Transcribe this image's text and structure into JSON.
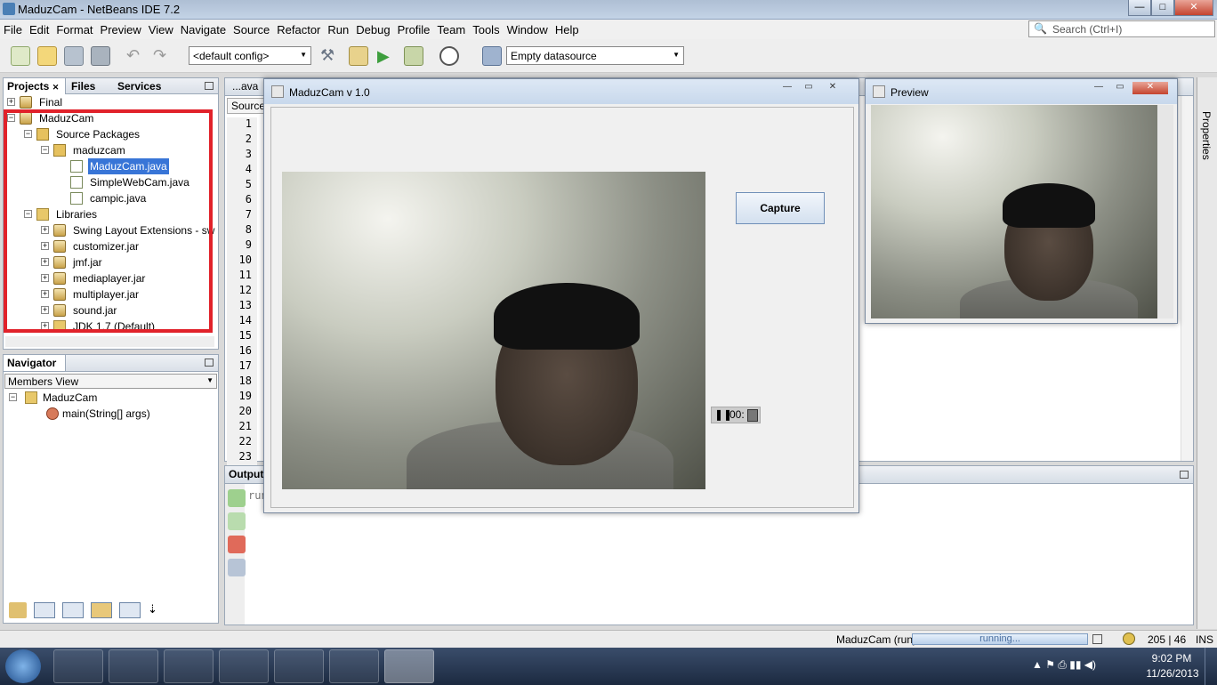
{
  "window": {
    "title": "MaduzCam - NetBeans IDE 7.2"
  },
  "menu": [
    "File",
    "Edit",
    "Format",
    "Preview",
    "View",
    "Navigate",
    "Source",
    "Refactor",
    "Run",
    "Debug",
    "Profile",
    "Team",
    "Tools",
    "Window",
    "Help"
  ],
  "search": {
    "placeholder": "Search (Ctrl+I)"
  },
  "toolbar": {
    "config": "<default config>",
    "datasource": "Empty datasource"
  },
  "projects_panel": {
    "tabs": [
      "Projects",
      "Files",
      "Services"
    ],
    "tree": [
      {
        "label": "Final"
      },
      {
        "label": "MaduzCam"
      },
      {
        "label": "Source Packages"
      },
      {
        "label": "maduzcam"
      },
      {
        "label": "MaduzCam.java"
      },
      {
        "label": "SimpleWebCam.java"
      },
      {
        "label": "campic.java"
      },
      {
        "label": "Libraries"
      },
      {
        "label": "Swing Layout Extensions - sw"
      },
      {
        "label": "customizer.jar"
      },
      {
        "label": "jmf.jar"
      },
      {
        "label": "mediaplayer.jar"
      },
      {
        "label": "multiplayer.jar"
      },
      {
        "label": "sound.jar"
      },
      {
        "label": "JDK 1.7 (Default)"
      }
    ]
  },
  "navigator": {
    "title": "Navigator",
    "view": "Members View",
    "class_name": "MaduzCam",
    "member": "main(String[] args)"
  },
  "editor": {
    "tab": "...ava",
    "source_tab": "Source",
    "line_numbers": [
      "1",
      "2",
      "3",
      "4",
      "5",
      "6",
      "7",
      "8",
      "9",
      "10",
      "11",
      "12",
      "13",
      "14",
      "15",
      "16",
      "17",
      "18",
      "19",
      "20",
      "21",
      "22",
      "23"
    ]
  },
  "output": {
    "title": "Output",
    "text": "run"
  },
  "app_dialog": {
    "title": "MaduzCam v 1.0",
    "capture_label": "Capture",
    "player_time": "00:"
  },
  "preview_dialog": {
    "title": "Preview"
  },
  "right_sidebar": {
    "label": "Properties"
  },
  "statusbar": {
    "project": "MaduzCam (run)",
    "progress": "running...",
    "position": "205 | 46",
    "mode": "INS"
  },
  "taskbar": {
    "time": "9:02 PM",
    "date": "11/26/2013"
  }
}
